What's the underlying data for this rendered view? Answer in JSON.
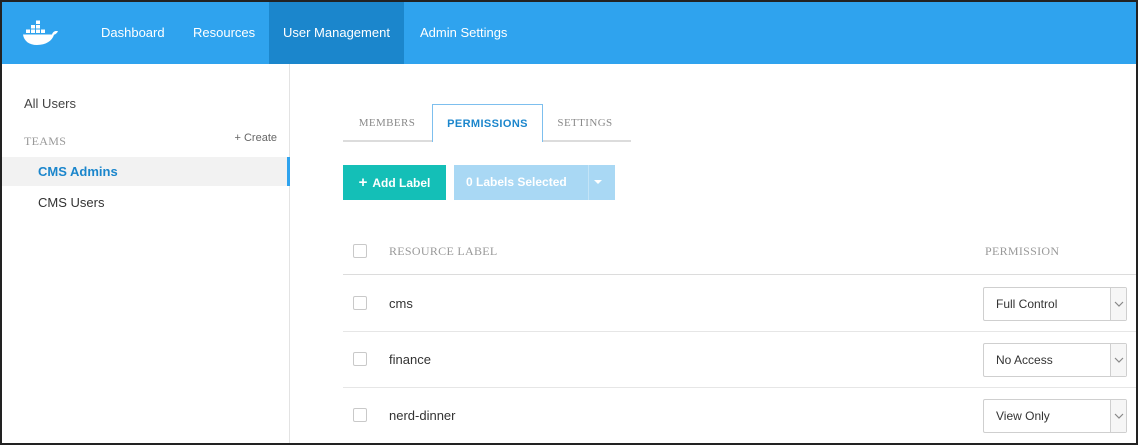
{
  "nav": {
    "logo": "docker-whale-icon",
    "items": [
      "Dashboard",
      "Resources",
      "User Management",
      "Admin Settings"
    ],
    "active_index": 2
  },
  "sidebar": {
    "all_users": "All Users",
    "teams_heading": "TEAMS",
    "create": "+ Create",
    "teams": [
      "CMS Admins",
      "CMS Users"
    ],
    "selected_index": 0
  },
  "tabs": [
    "MEMBERS",
    "PERMISSIONS",
    "SETTINGS"
  ],
  "active_tab": 1,
  "actions": {
    "add_label": "Add Label",
    "add_icon": "plus-icon",
    "labels_selected": "0 Labels Selected",
    "dropdown_icon": "caret-down-icon"
  },
  "table": {
    "header_label": "RESOURCE LABEL",
    "header_permission": "PERMISSION",
    "rows": [
      {
        "label": "cms",
        "permission": "Full Control"
      },
      {
        "label": "finance",
        "permission": "No Access"
      },
      {
        "label": "nerd-dinner",
        "permission": "View Only"
      }
    ]
  },
  "colors": {
    "topbar": "#2fa3ee",
    "topbar_active": "#1b86cc",
    "add_button": "#14bfb7",
    "labels_button": "#a9d8f4",
    "accent": "#1b86cc"
  }
}
